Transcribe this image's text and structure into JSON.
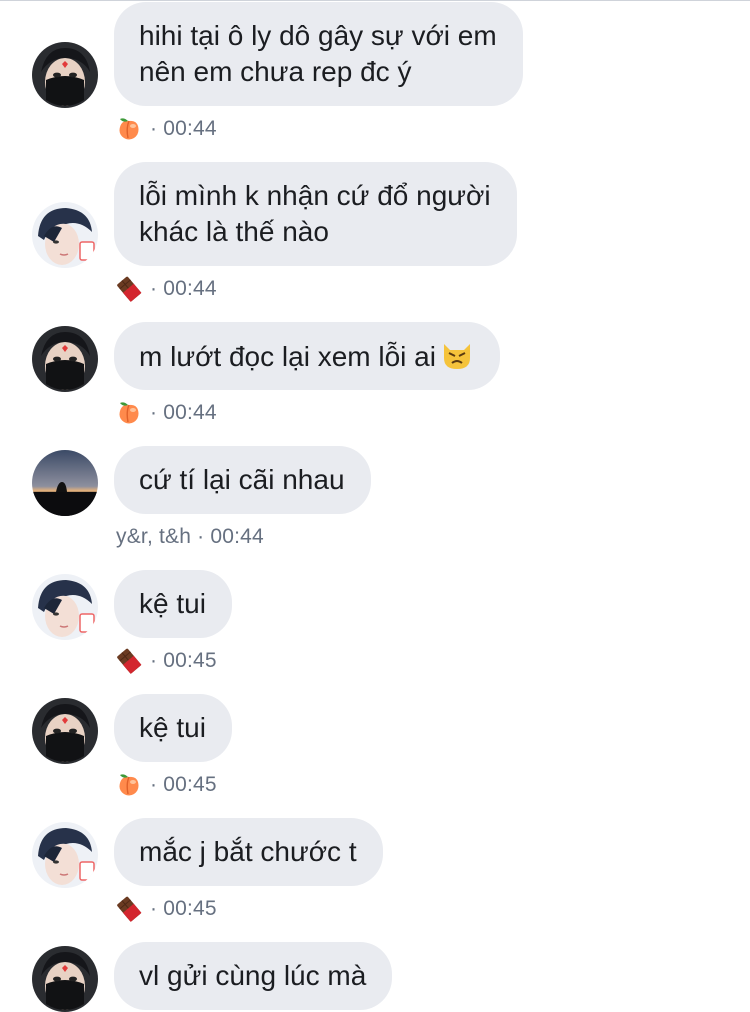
{
  "messages": [
    {
      "avatar": "masked",
      "text": "hihi tại ô ly dô gây sự với em\nnên em chưa rep đc ý",
      "reaction": "peach",
      "label": "",
      "sep": "·",
      "time": "00:44"
    },
    {
      "avatar": "boy",
      "text": "lỗi mình k nhận cứ đổ người\nkhác là thế nào",
      "reaction": "chocolate",
      "label": "",
      "sep": "·",
      "time": "00:44"
    },
    {
      "avatar": "masked",
      "text": "m lướt đọc lại xem lỗi ai",
      "emoji": "pouting-cat",
      "reaction": "peach",
      "label": "",
      "sep": "·",
      "time": "00:44"
    },
    {
      "avatar": "sunset",
      "text": "cứ tí lại cãi nhau",
      "reaction": "",
      "label": "y&r, t&h",
      "sep": "·",
      "time": "00:44"
    },
    {
      "avatar": "boy",
      "text": "kệ tui",
      "reaction": "chocolate",
      "label": "",
      "sep": "·",
      "time": "00:45"
    },
    {
      "avatar": "masked",
      "text": "kệ tui",
      "reaction": "peach",
      "label": "",
      "sep": "·",
      "time": "00:45"
    },
    {
      "avatar": "boy",
      "text": "mắc j bắt chước t",
      "reaction": "chocolate",
      "label": "",
      "sep": "·",
      "time": "00:45"
    },
    {
      "avatar": "masked",
      "text": "vl gửi cùng lúc mà",
      "reaction": "",
      "label": "",
      "sep": "",
      "time": ""
    }
  ],
  "colors": {
    "bubble": "#e9ebf0",
    "text": "#1b1d21",
    "meta": "#667080"
  }
}
